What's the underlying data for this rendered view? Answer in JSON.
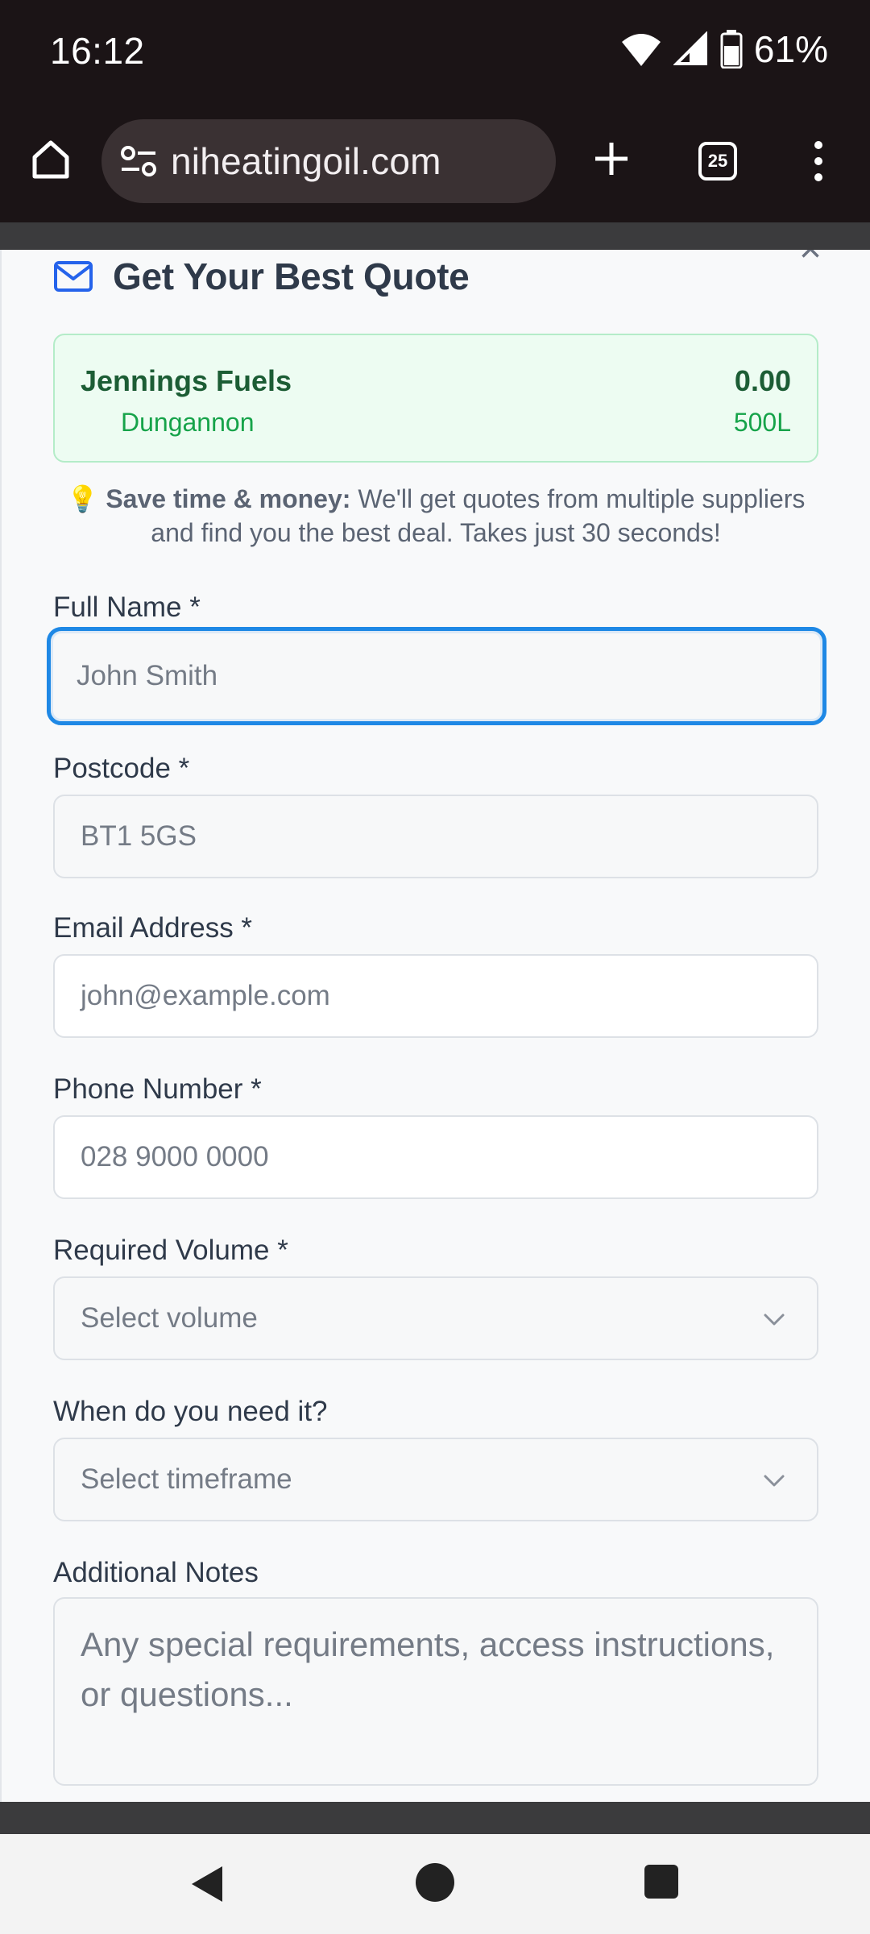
{
  "status_bar": {
    "time": "16:12",
    "battery_percent": "61%"
  },
  "browser": {
    "url": "niheatingoil.com",
    "tab_count": "25"
  },
  "modal": {
    "title": "Get Your Best Quote",
    "close_symbol": "×",
    "supplier": {
      "name": "Jennings Fuels",
      "location": "Dungannon",
      "price": "0.00",
      "volume": "500L"
    },
    "tip": {
      "emoji": "💡",
      "bold": "Save time & money:",
      "text": " We'll get quotes from multiple suppliers and find you the best deal. Takes just 30 seconds!"
    },
    "fields": {
      "full_name": {
        "label": "Full Name *",
        "placeholder": "John Smith"
      },
      "postcode": {
        "label": "Postcode *",
        "placeholder": "BT1 5GS"
      },
      "email": {
        "label": "Email Address *",
        "placeholder": "john@example.com"
      },
      "phone": {
        "label": "Phone Number *",
        "placeholder": "028 9000 0000"
      },
      "volume": {
        "label": "Required Volume *",
        "placeholder": "Select volume"
      },
      "timeframe": {
        "label": "When do you need it?",
        "placeholder": "Select timeframe"
      },
      "notes": {
        "label": "Additional Notes",
        "placeholder": "Any special requirements, access instructions, or questions..."
      }
    }
  },
  "colors": {
    "focus_ring": "#1e88e5",
    "accent_green": "#16a34a",
    "supplier_bg": "#edfcf2",
    "title": "#2f3a4a"
  }
}
